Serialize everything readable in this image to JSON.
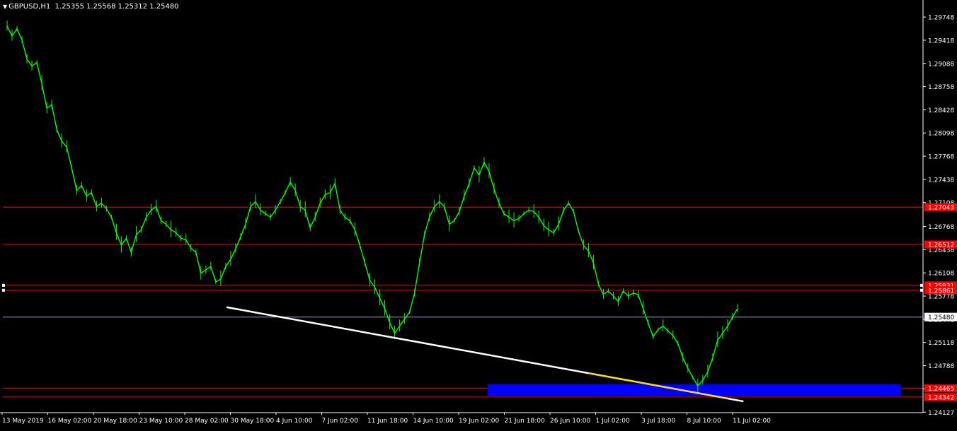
{
  "header": {
    "symbol_label": "GBPUSD,H1",
    "ohlc": "1.25355 1.25568 1.25312 1.25480",
    "menu_arrow": "triangle-down-icon"
  },
  "colors": {
    "background": "#000000",
    "price": "#00ff00",
    "level_line": "#ff0000",
    "current_line": "#8ea6c8",
    "trendline": "#ffffff",
    "trendline_tail": "#ffd700",
    "zone": "#0000ff",
    "axis_text": "#ffffff",
    "level_label_bg": "#ff0000"
  },
  "chart_data": {
    "type": "line",
    "title": "GBPUSD,H1",
    "ylim": [
      1.2412,
      1.2995
    ],
    "y_ticks": [
      "1.29748",
      "1.29418",
      "1.29088",
      "1.28758",
      "1.28428",
      "1.28098",
      "1.27768",
      "1.27438",
      "1.27108",
      "1.26768",
      "1.26438",
      "1.26108",
      "1.25778",
      "1.25448",
      "1.25118",
      "1.24788",
      "1.24458",
      "1.24127"
    ],
    "x_ticks": [
      "13 May 2019",
      "16 May 02:00",
      "20 May 18:00",
      "23 May 10:00",
      "28 May 02:00",
      "30 May 18:00",
      "4 Jun 10:00",
      "7 Jun 02:00",
      "11 Jun 18:00",
      "14 Jun 10:00",
      "19 Jun 02:00",
      "21 Jun 18:00",
      "26 Jun 10:00",
      "1 Jul 02:00",
      "3 Jul 18:00",
      "8 Jul 10:00",
      "11 Jul 02:00"
    ],
    "series": [
      {
        "values": [
          1.2962,
          1.2948,
          1.2958,
          1.2942,
          1.2915,
          1.2905,
          1.291,
          1.288,
          1.2845,
          1.285,
          1.2815,
          1.2798,
          1.279,
          1.276,
          1.2728,
          1.2735,
          1.272,
          1.2725,
          1.2705,
          1.271,
          1.2702,
          1.269,
          1.2668,
          1.265,
          1.266,
          1.264,
          1.2665,
          1.2672,
          1.269,
          1.27,
          1.2705,
          1.2685,
          1.268,
          1.2672,
          1.2668,
          1.266,
          1.2658,
          1.2646,
          1.264,
          1.261,
          1.2615,
          1.262,
          1.2598,
          1.2602,
          1.262,
          1.263,
          1.2645,
          1.2662,
          1.268,
          1.2705,
          1.2712,
          1.27,
          1.2695,
          1.269,
          1.27,
          1.2712,
          1.2725,
          1.274,
          1.2728,
          1.2705,
          1.27,
          1.2675,
          1.269,
          1.271,
          1.2722,
          1.2725,
          1.2738,
          1.27,
          1.269,
          1.2685,
          1.2672,
          1.265,
          1.2625,
          1.26,
          1.259,
          1.2575,
          1.256,
          1.254,
          1.2525,
          1.2535,
          1.2545,
          1.2555,
          1.2582,
          1.2625,
          1.2665,
          1.269,
          1.2705,
          1.2712,
          1.2705,
          1.268,
          1.2685,
          1.2698,
          1.272,
          1.2738,
          1.276,
          1.275,
          1.2768,
          1.2755,
          1.273,
          1.271,
          1.2695,
          1.269,
          1.2685,
          1.2688,
          1.2695,
          1.27,
          1.2698,
          1.269,
          1.2678,
          1.2672,
          1.2668,
          1.268,
          1.27,
          1.271,
          1.2698,
          1.267,
          1.265,
          1.2642,
          1.2625,
          1.2595,
          1.258,
          1.2585,
          1.2578,
          1.257,
          1.2585,
          1.2578,
          1.2582,
          1.258,
          1.256,
          1.254,
          1.252,
          1.253,
          1.2535,
          1.2528,
          1.2522,
          1.251,
          1.249,
          1.2475,
          1.2462,
          1.245,
          1.2458,
          1.247,
          1.249,
          1.2515,
          1.2525,
          1.2535,
          1.2548,
          1.256
        ]
      }
    ],
    "levels": [
      {
        "label": "1.27043",
        "value": 1.27043
      },
      {
        "label": "1.26512",
        "value": 1.26512
      },
      {
        "label": "1.25931",
        "value": 1.25931
      },
      {
        "label": "1.25861",
        "value": 1.25861
      },
      {
        "label": "1.24465",
        "value": 1.24465
      },
      {
        "label": "1.24342",
        "value": 1.24342
      }
    ],
    "current_price": {
      "label": "1.25480",
      "value": 1.2548
    },
    "trendline": {
      "x_start": 0.2431,
      "x_end": 0.8048,
      "y_start": 1.2562,
      "y_end": 1.2428
    },
    "demand_zone": {
      "x_start": 0.5268,
      "x_end": 0.9759,
      "y_low": 1.24358,
      "y_high": 1.24525
    },
    "grid": false
  }
}
